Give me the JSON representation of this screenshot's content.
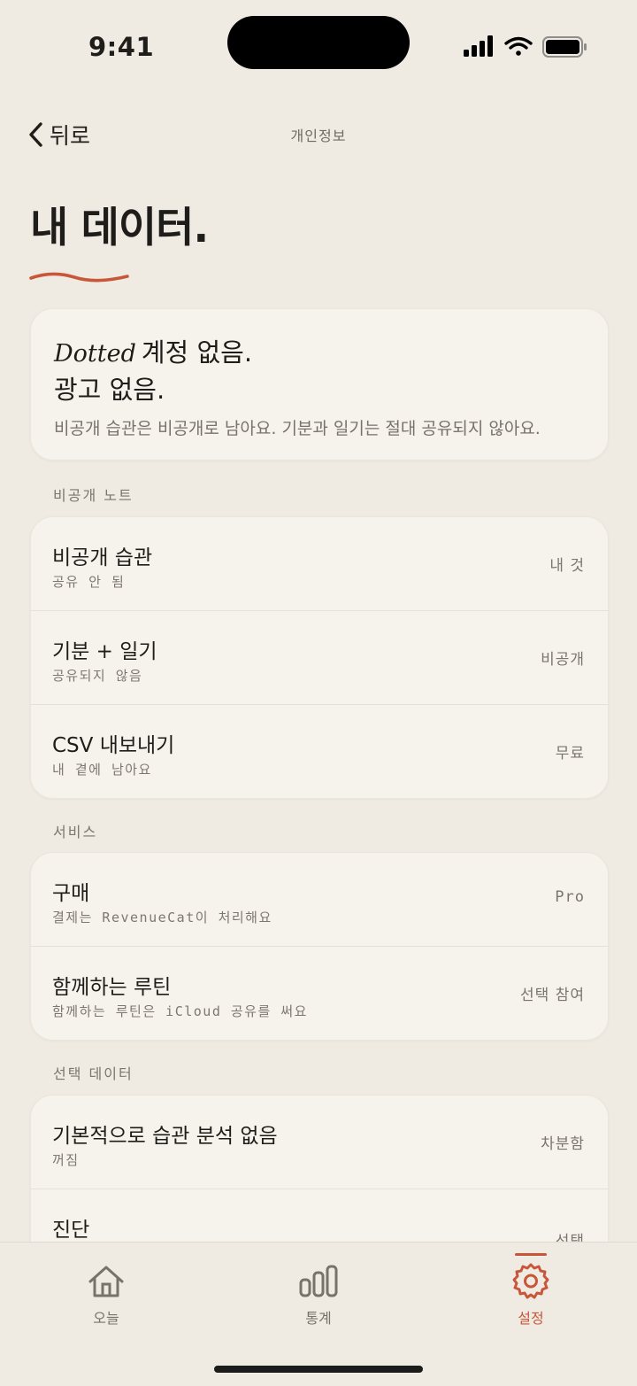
{
  "status": {
    "time": "9:41"
  },
  "nav": {
    "back_label": "뒤로",
    "title": "개인정보"
  },
  "page": {
    "title": "내 데이터."
  },
  "hero": {
    "brand": "Dotted",
    "line1": "계정 없음.",
    "line2": "광고 없음.",
    "description": "비공개 습관은 비공개로 남아요. 기분과 일기는 절대 공유되지 않아요."
  },
  "sections": {
    "private_notes": {
      "label": "비공개 노트",
      "rows": [
        {
          "title": "비공개 습관",
          "subtitle": "공유 안 됨",
          "value": "내 것"
        },
        {
          "title": "기분 + 일기",
          "subtitle": "공유되지 않음",
          "value": "비공개"
        },
        {
          "title": "CSV 내보내기",
          "subtitle": "내 곁에 남아요",
          "value": "무료"
        }
      ]
    },
    "services": {
      "label": "서비스",
      "rows": [
        {
          "title": "구매",
          "subtitle": "결제는 RevenueCat이 처리해요",
          "value": "Pro"
        },
        {
          "title": "함께하는 루틴",
          "subtitle": "함께하는 루틴은 iCloud 공유를 써요",
          "value": "선택 참여"
        }
      ]
    },
    "optional_data": {
      "label": "선택 데이터",
      "rows": [
        {
          "title": "기본적으로 습관 분석 없음",
          "subtitle": "꺼짐",
          "value": "차분함"
        },
        {
          "title": "진단",
          "subtitle": "",
          "value": "선택"
        }
      ]
    }
  },
  "tabs": [
    {
      "label": "오늘",
      "icon": "home-icon"
    },
    {
      "label": "통계",
      "icon": "bar-chart-icon"
    },
    {
      "label": "설정",
      "icon": "gear-icon",
      "active": true
    }
  ],
  "colors": {
    "background": "#efebe3",
    "accent": "#c8573a",
    "card": "#f6f3ec"
  }
}
